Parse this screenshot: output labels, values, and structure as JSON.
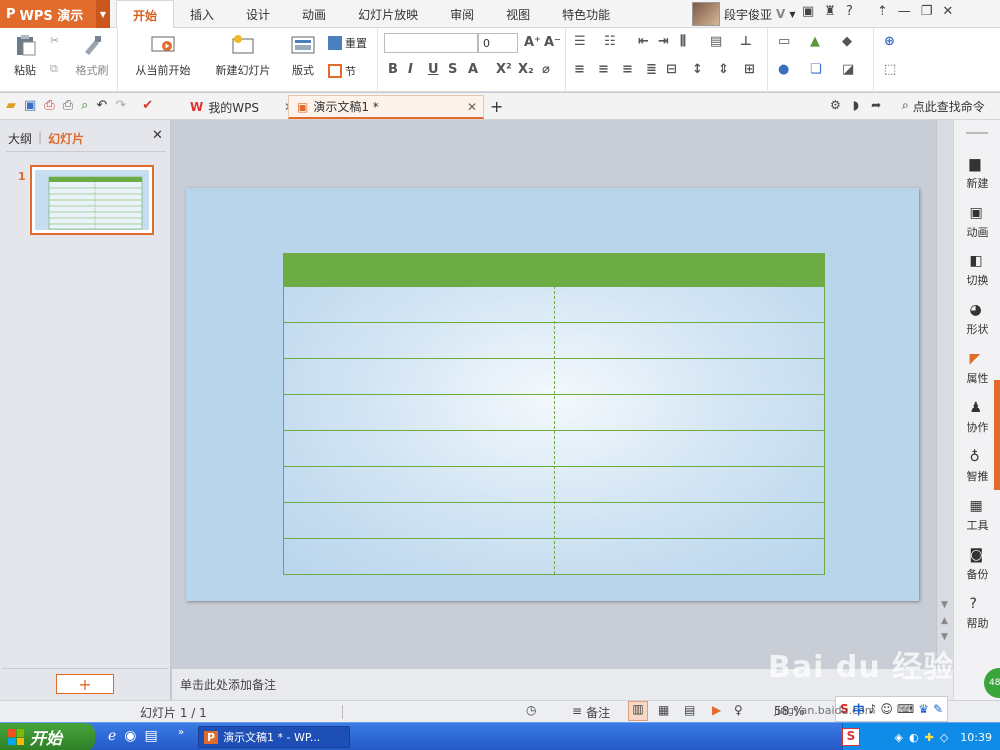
{
  "app": {
    "name": "WPS 演示",
    "logo": "P"
  },
  "ribbon_tabs": [
    "开始",
    "插入",
    "设计",
    "动画",
    "幻灯片放映",
    "审阅",
    "视图",
    "特色功能"
  ],
  "user": {
    "name": "段宇俊亚"
  },
  "ribbon": {
    "paste": "粘贴",
    "format_painter": "格式刷",
    "from_current": "从当前开始",
    "new_slide": "新建幻灯片",
    "layout": "版式",
    "reset": "重置",
    "section": "节",
    "font_size": "0",
    "font_name": ""
  },
  "doc_tabs": [
    {
      "label": "我的WPS"
    },
    {
      "label": "演示文稿1 *"
    }
  ],
  "find_command": "点此查找命令",
  "left_panel": {
    "tab_outline": "大纲",
    "tab_slides": "幻灯片",
    "slide_number": "1",
    "add": "+"
  },
  "notes_placeholder": "单击此处添加备注",
  "right_sidebar": [
    "新建",
    "动画",
    "切换",
    "形状",
    "属性",
    "协作",
    "智推",
    "工具",
    "备份",
    "帮助"
  ],
  "status": {
    "slide_info": "幻灯片 1 / 1",
    "notes": "备注",
    "zoom": "58 %"
  },
  "taskbar": {
    "start": "开始",
    "task": "演示文稿1 * - WP...",
    "clock": "10:39",
    "ime": "中"
  },
  "watermark": {
    "text": "Bai du 经验",
    "url": "jingyan.baidu.com"
  },
  "colors": {
    "accent": "#e06b2d",
    "table_green": "#6dab45",
    "slide_bg": "#b8d5ec"
  }
}
